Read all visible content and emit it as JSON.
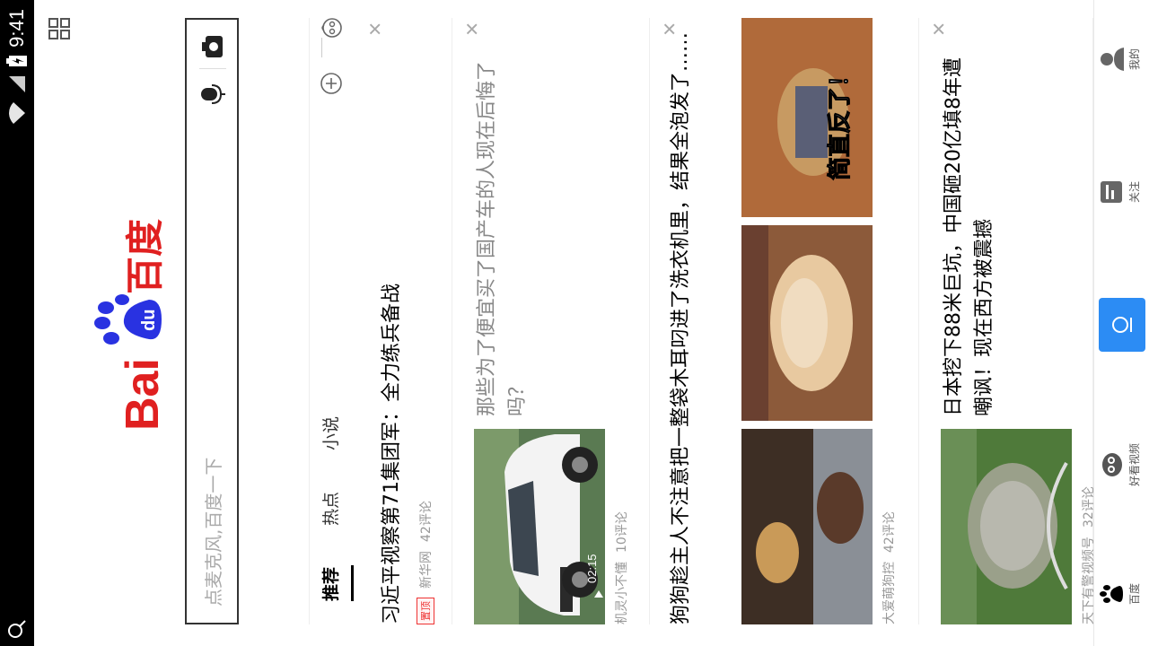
{
  "status_bar": {
    "time": "9:41"
  },
  "search": {
    "placeholder": "点麦克风,百度一下"
  },
  "logo": {
    "text_left": "Bai",
    "text_du": "du",
    "text_cn": "百度"
  },
  "tabs": [
    {
      "label": "推荐",
      "active": true
    },
    {
      "label": "热点",
      "active": false
    },
    {
      "label": "小说",
      "active": false
    }
  ],
  "feed": [
    {
      "title": "习近平视察第71集团军：全力练兵备战",
      "badge": "置顶",
      "source": "新华网",
      "comments": "42评论"
    },
    {
      "title": "那些为了便宜买了国产车的人现在后悔了吗？",
      "duration": "02:15",
      "source": "机灵小不懂",
      "comments": "10评论"
    },
    {
      "title": "狗狗趁主人不注意把一整袋木耳叼进了洗衣机里，结果全泡发了……",
      "image_caption": "简直反了！",
      "source": "大爱萌狗控",
      "comments": "42评论"
    },
    {
      "title": "日本挖下88米巨坑，中国砸20亿填8年遭嘲讽！现在西方被震撼",
      "source": "天下有警视频号",
      "comments": "32评论"
    }
  ],
  "bottom_nav": [
    {
      "label": "百度",
      "icon": "paw-icon"
    },
    {
      "label": "好看视频",
      "icon": "video-face-icon"
    },
    {
      "label": "",
      "icon": "voice-search-icon"
    },
    {
      "label": "关注",
      "icon": "follow-icon"
    },
    {
      "label": "我的",
      "icon": "user-icon"
    }
  ],
  "colors": {
    "brand_red": "#e02020",
    "brand_blue": "#2932e1",
    "voice_blue": "#2c8cf4"
  }
}
